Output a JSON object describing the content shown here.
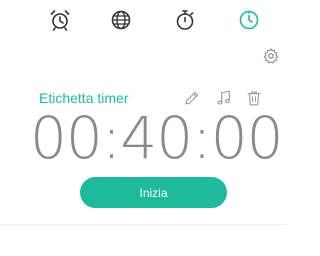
{
  "tabs": [
    {
      "name": "alarm",
      "icon": "alarm-clock-icon",
      "active": false
    },
    {
      "name": "world-clock",
      "icon": "globe-icon",
      "active": false
    },
    {
      "name": "stopwatch",
      "icon": "stopwatch-icon",
      "active": false
    },
    {
      "name": "timer",
      "icon": "timer-icon",
      "active": true
    }
  ],
  "timer": {
    "label": "Etichetta timer",
    "time": "00:40:00",
    "start_label": "Inizia"
  },
  "icons": {
    "settings": "gear-icon",
    "edit": "pencil-icon",
    "sound": "music-note-icon",
    "delete": "trash-icon"
  },
  "colors": {
    "accent": "#22b99a",
    "icon": "#333333",
    "icon_muted": "#9a9a9a",
    "time_text": "#8a8a8a"
  }
}
